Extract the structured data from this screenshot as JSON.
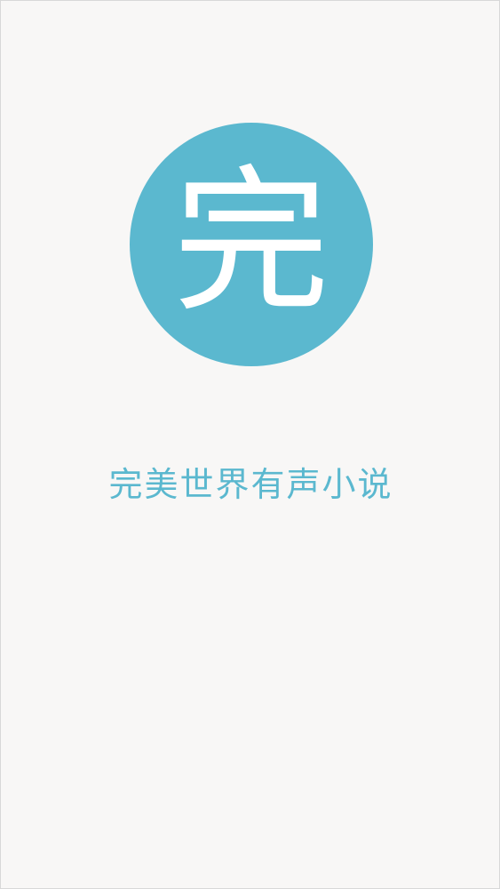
{
  "splash": {
    "logo_char": "完",
    "app_title": "完美世界有声小说"
  },
  "colors": {
    "background": "#f8f7f6",
    "brand": "#5bb8cf",
    "logo_text": "#ffffff"
  }
}
